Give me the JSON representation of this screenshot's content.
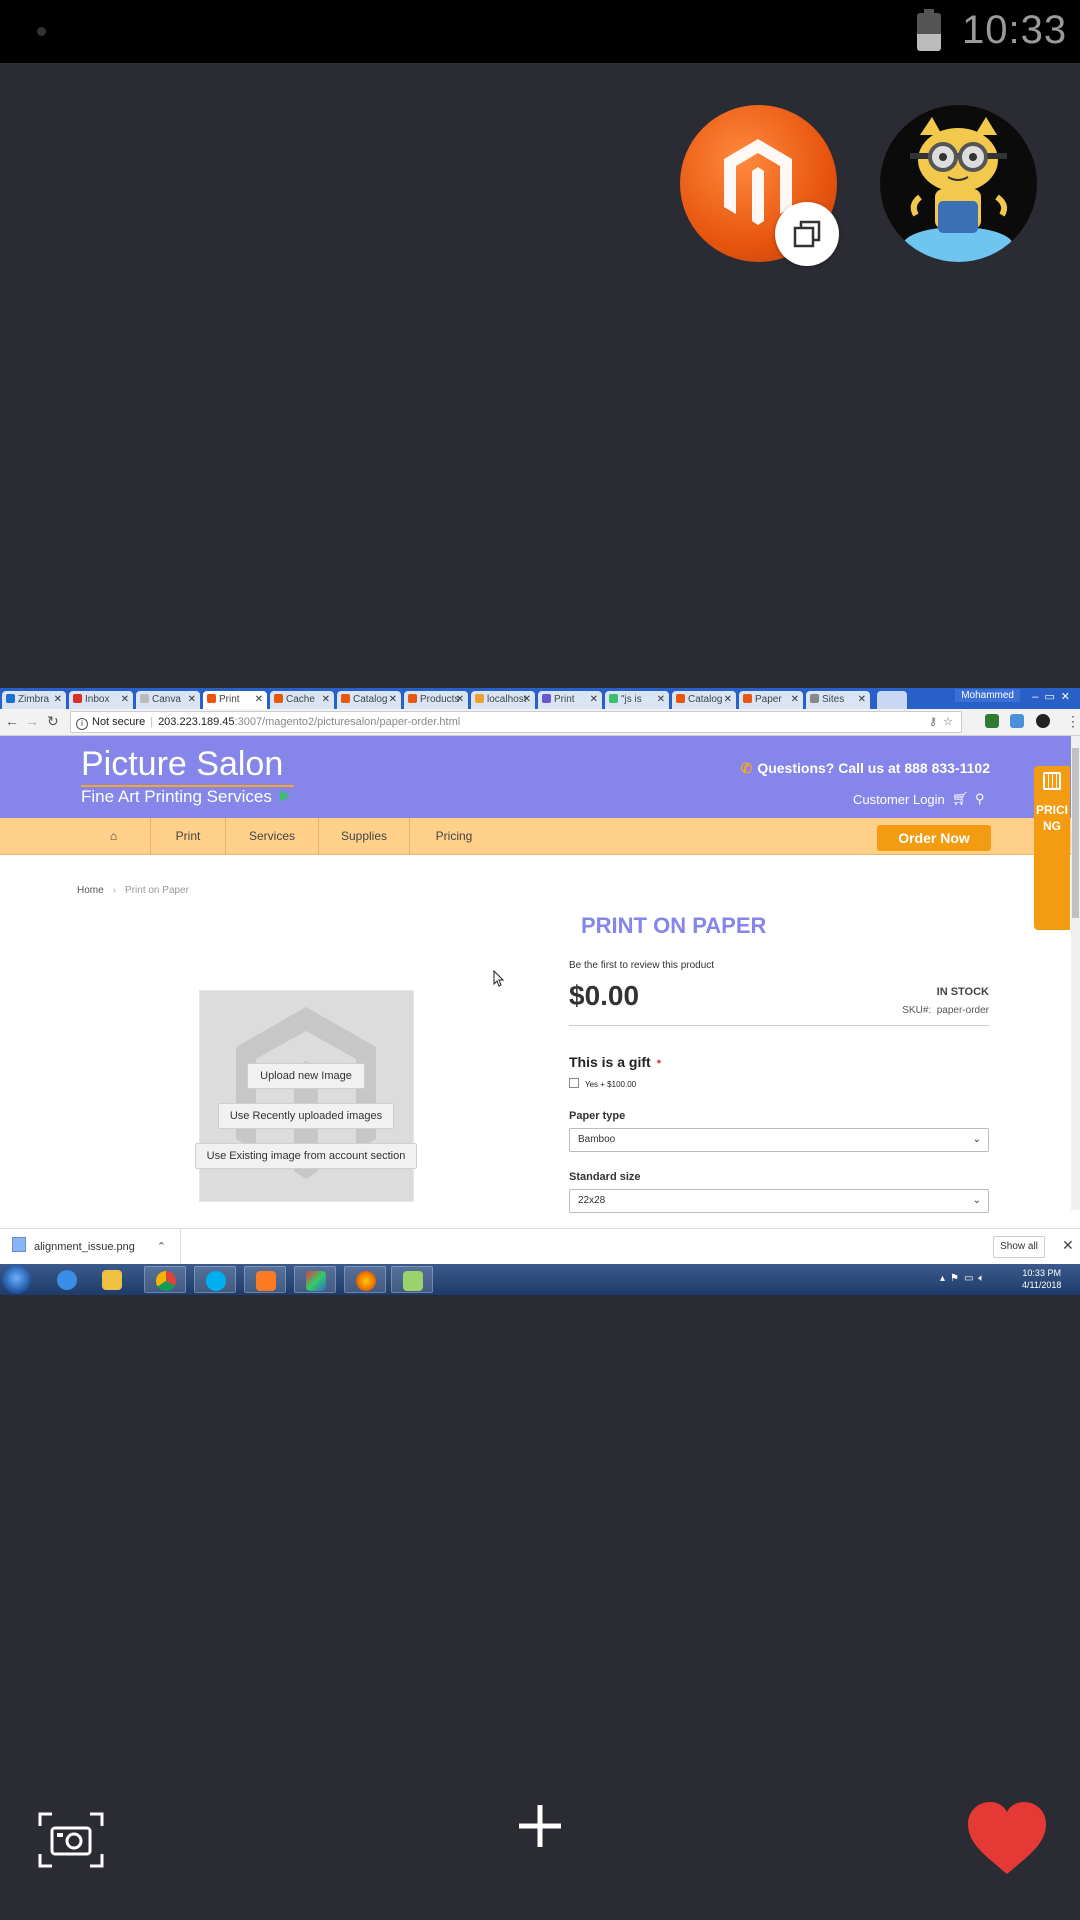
{
  "status_bar": {
    "time": "10:33"
  },
  "chrome": {
    "tabs": [
      {
        "label": "Zimbra",
        "icon": "zimbra-icon",
        "color": "#1f6fd1"
      },
      {
        "label": "Inbox",
        "icon": "gmail-icon",
        "color": "#d93025"
      },
      {
        "label": "Canva",
        "icon": "loading-icon",
        "color": "#bbbbbb"
      },
      {
        "label": "Print",
        "icon": "magento-icon",
        "color": "#e8560f",
        "active": true
      },
      {
        "label": "Cache",
        "icon": "magento-icon",
        "color": "#e8560f"
      },
      {
        "label": "Catalog",
        "icon": "magento-icon",
        "color": "#e8560f"
      },
      {
        "label": "Products",
        "icon": "magento-icon",
        "color": "#e8560f"
      },
      {
        "label": "localhost",
        "icon": "phpmyadmin-icon",
        "color": "#f0a030"
      },
      {
        "label": "Print",
        "icon": "picture-icon",
        "color": "#6a5acd"
      },
      {
        "label": "\"js is",
        "icon": "stackoverflow-icon",
        "color": "#3ac06a"
      },
      {
        "label": "Catalog",
        "icon": "magento-icon",
        "color": "#e8560f"
      },
      {
        "label": "Paper",
        "icon": "magento-icon",
        "color": "#e8560f"
      },
      {
        "label": "Sites",
        "icon": "settings-icon",
        "color": "#888888"
      }
    ],
    "profile_name": "Mohammed",
    "not_secure_label": "Not secure",
    "url_host": "203.223.189.45",
    "url_rest": ":3007/magento2/picturesalon/paper-order.html"
  },
  "site": {
    "logo_title": "Picture Salon",
    "logo_subtitle": "Fine Art Printing Services",
    "phone_cta": "Questions? Call us at 888 833-1102",
    "customer_login": "Customer Login",
    "nav": [
      "Print",
      "Services",
      "Supplies",
      "Pricing"
    ],
    "order_now": "Order Now",
    "pricing_tab": "PRICING",
    "breadcrumb": {
      "home": "Home",
      "current": "Print on Paper"
    }
  },
  "product": {
    "title": "PRINT ON PAPER",
    "review_link": "Be the first to review this product",
    "price": "$0.00",
    "stock": "IN STOCK",
    "sku_label": "SKU#:",
    "sku": "paper-order",
    "gift_title": "This is a gift",
    "gift_required": "*",
    "gift_option": "Yes + $100.00",
    "paper_type_label": "Paper type",
    "paper_type_value": "Bamboo",
    "size_label": "Standard size",
    "size_value": "22x28",
    "upload_buttons": [
      "Upload new Image",
      "Use Recently uploaded images",
      "Use Existing image from account section"
    ]
  },
  "downloads": {
    "file": "alignment_issue.png",
    "show_all": "Show all"
  },
  "taskbar": {
    "time": "10:33 PM",
    "date": "4/11/2018"
  }
}
